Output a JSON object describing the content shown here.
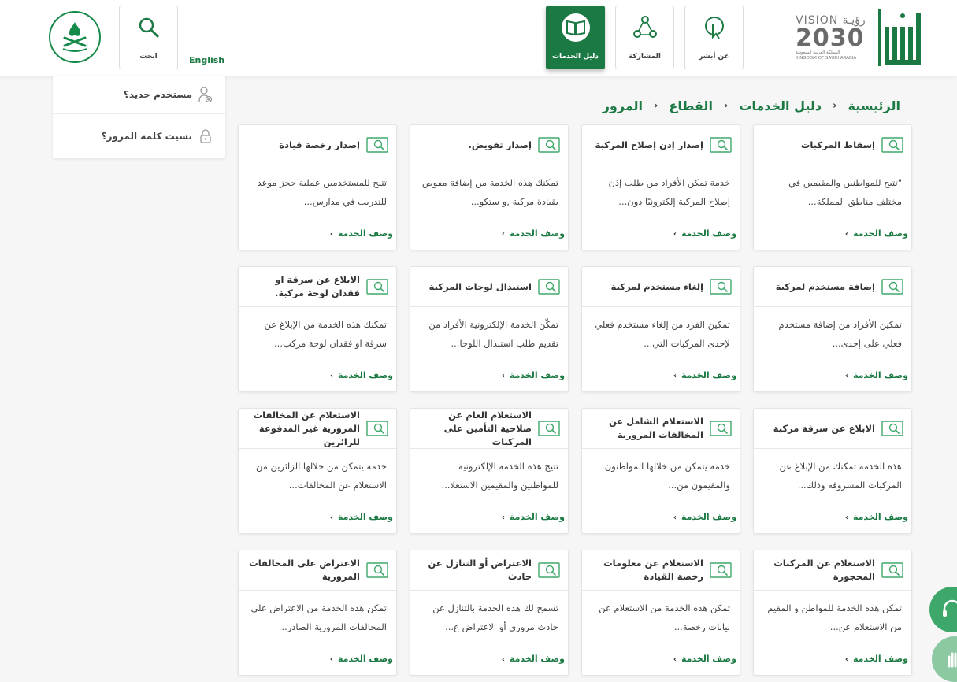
{
  "header": {
    "search_label": "ابحث",
    "language_link": "English",
    "nav": [
      {
        "label": "دليل الخدمات",
        "icon": "book-icon",
        "active": true
      },
      {
        "label": "المشاركة",
        "icon": "share-icon",
        "active": false
      },
      {
        "label": "عن أبشر",
        "icon": "pointer-icon",
        "active": false
      }
    ],
    "vision": {
      "top": "VISION رؤيـة",
      "year": "2030",
      "sub_ar": "المملكة العربية السعودية",
      "sub_en": "KINGDOM OF SAUDI ARABIA"
    },
    "colors": {
      "brand": "#1b7a43",
      "accent": "#3ea86b"
    }
  },
  "sidebar": {
    "items": [
      {
        "label": "مستخدم جديد؟",
        "icon": "add-user-icon"
      },
      {
        "label": "نسيت كلمة المرور؟",
        "icon": "lock-icon"
      }
    ]
  },
  "breadcrumb": [
    "الرئيسية",
    "دليل الخدمات",
    "القطاع",
    "المرور"
  ],
  "link_label": "وصف الخدمة",
  "cards": [
    {
      "title": "إسقاط المركبات",
      "desc": "\"تتيح للمواطنين والمقيمين في مختلف مناطق المملكة..."
    },
    {
      "title": "إصدار إذن إصلاح المركبة",
      "desc": "خدمة تمكن الأفراد من طلب إذن إصلاح المركبة إلكترونيًا دون..."
    },
    {
      "title": "إصدار تفويض.",
      "desc": "تمكنك هذه الخدمة من إضافة مفوض بقيادة مركبة ,و ستكو..."
    },
    {
      "title": "إصدار رخصة قيادة",
      "desc": "تتيح للمستخدمين عملية حجز موعد للتدريب في مدارس..."
    },
    {
      "title": "إضافة مستخدم لمركبة",
      "desc": "تمكين الأفراد من إضافة مستخدم فعلي على إحدى..."
    },
    {
      "title": "إلغاء مستخدم لمركبة",
      "desc": "تمكين الفرد من إلغاء مستخدم فعلي لإحدى المركبات التي..."
    },
    {
      "title": "استبدال لوحات المركبة",
      "desc": "تمكّن الخدمة الإلكترونية الأفراد من تقديم طلب استبدال اللوحا..."
    },
    {
      "title": "الابلاغ عن سرقة او فقدان لوحة مركبة.",
      "desc": "تمكنك هذه الخدمة من الإبلاغ عن سرقة او فقدان لوحة مركب..."
    },
    {
      "title": "الابلاغ عن سرقة مركبة",
      "desc": "هذه الخدمة تمكنك من الإبلاغ عن المركبات المسروقة وذلك..."
    },
    {
      "title": "الاستعلام الشامل عن المخالفات المرورية",
      "desc": "خدمة يتمكن من خلالها المواطنون والمقيمون من..."
    },
    {
      "title": "الاستعلام العام عن صلاحية التأمين على المركبات",
      "desc": "تتيح هذه الخدمة الإلكترونية للمواطنين والمقيمين الاستعلا..."
    },
    {
      "title": "الاستعلام عن المخالفات المرورية غير المدفوعة للزائرين",
      "desc": "خدمة يتمكن من خلالها الزائرين من الاستعلام عن المخالفات..."
    },
    {
      "title": "الاستعلام عن المركبات المحجوزة",
      "desc": "تمكن هذه الخدمة للمواطن و المقيم من الاستعلام عن..."
    },
    {
      "title": "الاستعلام عن معلومات رخصة القيادة",
      "desc": "تمكن هذه الخدمة من الاستعلام عن بيانات رخصة..."
    },
    {
      "title": "الاعتراض أو التنازل عن حادث",
      "desc": "تسمح لك هذه الخدمة بالتنازل عن حادث مروري أو الاعتراض ع..."
    },
    {
      "title": "الاعتراض على المخالفات المرورية",
      "desc": "تمكن هذه الخدمة من الاعتراض على المخالفات المرورية الصادر..."
    }
  ]
}
